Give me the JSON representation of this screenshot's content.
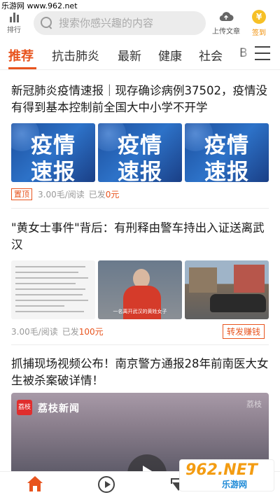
{
  "watermark_top": "乐游网 www.962.net",
  "header": {
    "rank_label": "排行",
    "search_placeholder": "搜索你感兴趣的内容",
    "upload_label": "上传文章",
    "sign_label": "签到",
    "coin_glyph": "¥"
  },
  "tabs": [
    "推荐",
    "抗击肺炎",
    "最新",
    "健康",
    "社会",
    "B"
  ],
  "articles": [
    {
      "title": "新冠肺炎疫情速报｜现存确诊病例37502，疫情没有得到基本控制前全国大中小学不开学",
      "images": [
        {
          "line1": "疫情",
          "line2": "速报"
        },
        {
          "line1": "疫情",
          "line2": "速报"
        },
        {
          "line1": "疫情",
          "line2": "速报"
        }
      ],
      "badge": "置顶",
      "price": "3.00毛/阅读",
      "paid_label": "已发",
      "paid_amount": "0元"
    },
    {
      "title": "\"黄女士事件\"背后：有刑释由警车持出入证送离武汉",
      "caption": "一名离开武汉的黄姓女子",
      "price": "3.00毛/阅读",
      "paid_label": "已发",
      "paid_amount": "100元",
      "share_label": "转发赚钱"
    },
    {
      "title": "抓捕现场视频公布！南京警方通报28年前南医大女生被杀案破详情！",
      "video_brand": "荔枝新闻",
      "video_logo": "荔枝",
      "video_corner": "荔枝"
    }
  ],
  "watermark_bottom": {
    "big": "962.NET",
    "small": "乐游网"
  },
  "colors": {
    "accent": "#e8541e",
    "coin": "#f6c026",
    "epidemic_blue": "#1c4e9c"
  },
  "icons": [
    "rank-icon",
    "search-icon",
    "cloud-upload-icon",
    "coin-icon",
    "menu-icon",
    "home-icon",
    "video-play-icon",
    "diamond-icon"
  ]
}
